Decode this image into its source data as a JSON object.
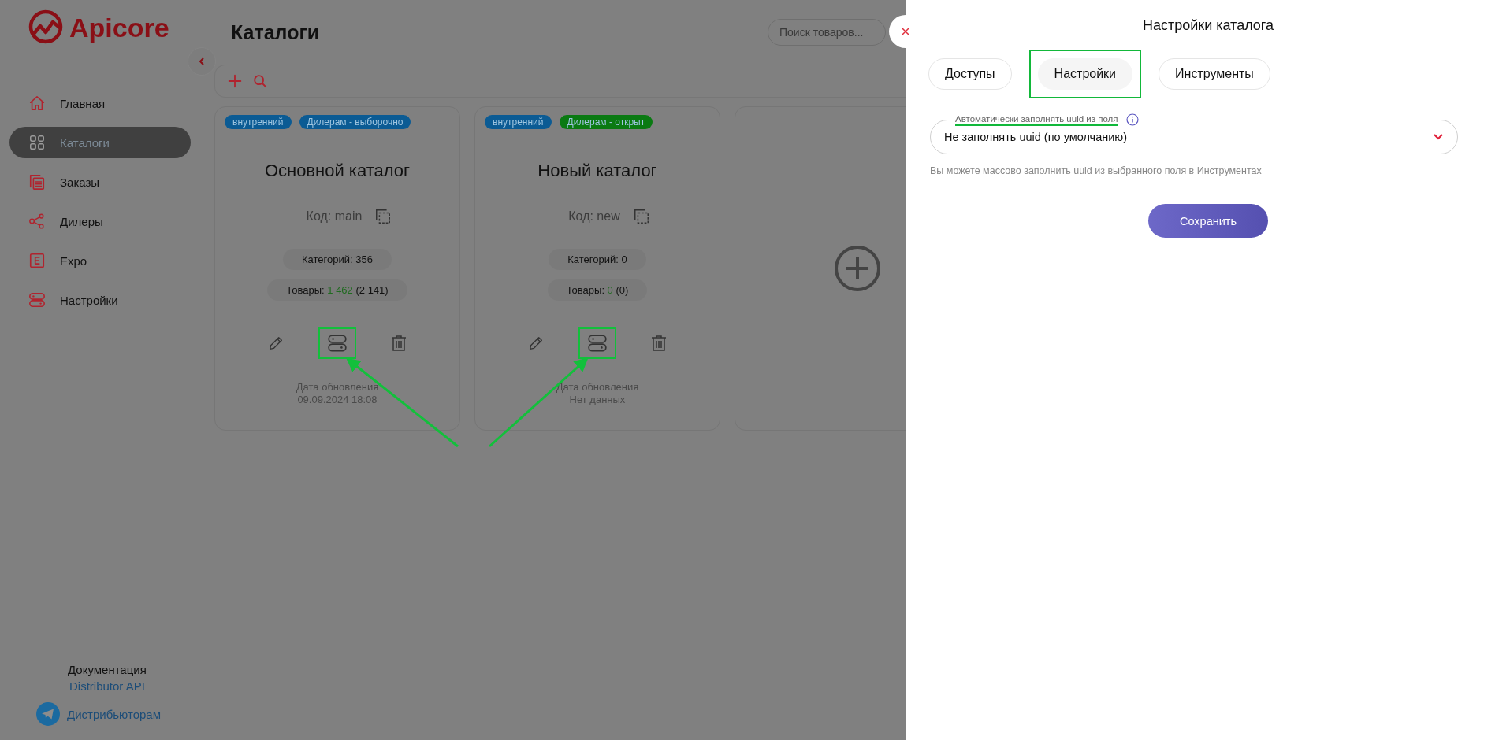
{
  "logo": {
    "text": "Apicore"
  },
  "sidebar": {
    "items": [
      {
        "label": "Главная",
        "selected": false
      },
      {
        "label": "Каталоги",
        "selected": true
      },
      {
        "label": "Заказы",
        "selected": false
      },
      {
        "label": "Дилеры",
        "selected": false
      },
      {
        "label": "Expo",
        "selected": false
      },
      {
        "label": "Настройки",
        "selected": false
      }
    ],
    "footer": {
      "docs_label": "Документация",
      "docs_link": "Distributor API",
      "telegram_link": "Дистрибьюторам"
    }
  },
  "page": {
    "title": "Каталоги",
    "search": {
      "placeholder": "Поиск товаров..."
    }
  },
  "cards": [
    {
      "kind": "catalog",
      "badges": [
        {
          "text": "внутренний",
          "color": "#0b5b94"
        },
        {
          "text": "Дилерам - выборочно",
          "color": "#0b5b94"
        }
      ],
      "title": "Основной каталог",
      "code": "Код: main",
      "categories": "Категорий: 356",
      "products_label": "Товары:",
      "products_active": "1 462",
      "products_total": "(2 141)",
      "settings_highlighted": true,
      "date_label": "Дата обновления",
      "date": "09.09.2024 18:08"
    },
    {
      "kind": "catalog",
      "badges": [
        {
          "text": "внутренний",
          "color": "#0b5b94"
        },
        {
          "text": "Дилерам - открыт",
          "color": "#0a7a12"
        }
      ],
      "title": "Новый каталог",
      "code": "Код: new",
      "categories": "Категорий: 0",
      "products_label": "Товары:",
      "products_active": "0",
      "products_total": "(0)",
      "settings_highlighted": true,
      "date_label": "Дата обновления",
      "date": "Нет данных"
    },
    {
      "kind": "add"
    }
  ],
  "drawer": {
    "title": "Настройки каталога",
    "tabs": [
      {
        "label": "Доступы",
        "selected": false,
        "highlighted": false
      },
      {
        "label": "Настройки",
        "selected": true,
        "highlighted": true
      },
      {
        "label": "Инструменты",
        "selected": false,
        "highlighted": false
      }
    ],
    "field": {
      "label": "Автоматически заполнять uuid из поля",
      "label_underlined": true,
      "value": "Не заполнять uuid (по умолчанию)"
    },
    "hint": "Вы можете массово заполнить uuid из выбранного поля в Инструментах",
    "save": "Сохранить"
  }
}
